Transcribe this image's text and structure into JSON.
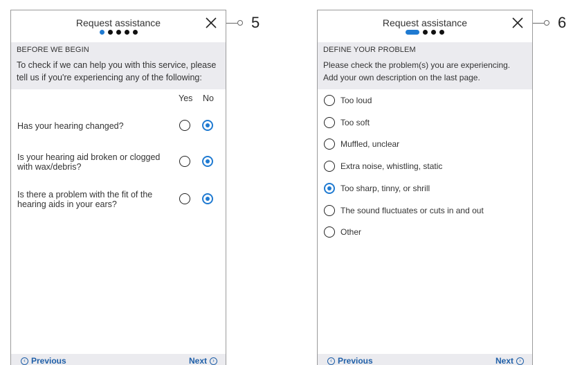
{
  "left": {
    "title": "Request assistance",
    "dots": 5,
    "active_dot": 0,
    "section_heading": "BEFORE WE BEGIN",
    "section_desc": "To check if we can help you with this service, please tell us if you're experiencing any of the following:",
    "col_yes": "Yes",
    "col_no": "No",
    "questions": [
      {
        "text": "Has your hearing changed?",
        "answer": "No"
      },
      {
        "text": "Is your hearing aid broken or clogged with wax/debris?",
        "answer": "No"
      },
      {
        "text": "Is there a problem with the fit of the hearing aids in your ears?",
        "answer": "No"
      }
    ],
    "previous_label": "Previous",
    "next_label": "Next",
    "callout_number": "5"
  },
  "right": {
    "title": "Request assistance",
    "dots": 4,
    "active_dot": 0,
    "section_heading": "DEFINE YOUR PROBLEM",
    "section_desc": "Please check the problem(s) you are experiencing. Add your own description on the last page.",
    "options": [
      {
        "label": "Too loud",
        "checked": false
      },
      {
        "label": "Too soft",
        "checked": false
      },
      {
        "label": "Muffled, unclear",
        "checked": false
      },
      {
        "label": "Extra noise, whistling, static",
        "checked": false
      },
      {
        "label": "Too sharp, tinny, or shrill",
        "checked": true
      },
      {
        "label": "The sound fluctuates or cuts in and out",
        "checked": false
      },
      {
        "label": "Other",
        "checked": false
      }
    ],
    "previous_label": "Previous",
    "next_label": "Next",
    "callout_number": "6"
  },
  "icons": {
    "close": "close-icon",
    "previous": "chevron-left-circle-icon",
    "next": "chevron-right-circle-icon"
  },
  "colors": {
    "accent": "#1f7ad1",
    "link": "#1f5fa8",
    "section_bg": "#ebebef"
  }
}
